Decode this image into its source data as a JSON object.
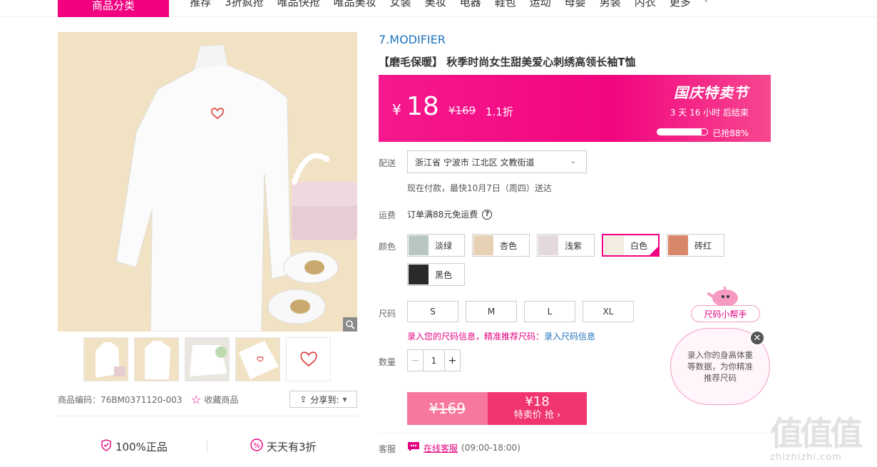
{
  "nav": {
    "category_button": "商品分类",
    "items": [
      "推荐",
      "3折疯抢",
      "唯品快抢",
      "唯品美妆",
      "女装",
      "美妆",
      "电器",
      "鞋包",
      "运动",
      "母婴",
      "男装",
      "内衣",
      "更多"
    ]
  },
  "gallery": {
    "product_code_label": "商品编码：76BM0371120-003",
    "favorite_label": "收藏商品",
    "share_label": "分享到:"
  },
  "guarantees": {
    "authentic": "100%正品",
    "daily_discount": "天天有3折"
  },
  "product": {
    "brand": "7.MODIFIER",
    "title": "【磨毛保暖】 秋季时尚女生甜美爱心刺绣高领长袖T恤"
  },
  "price_banner": {
    "currency": "¥",
    "price": "18",
    "original_price": "¥169",
    "discount": "1.1折",
    "festival": "国庆特卖节",
    "countdown": "3  天  16  小时  后结束",
    "sold_label": "已抢88%",
    "sold_fraction": 0.88
  },
  "delivery": {
    "label": "配送",
    "address": "浙江省 宁波市 江北区 文教街道",
    "note": "现在付款，最快10月7日（周四）送达"
  },
  "shipping": {
    "label": "运费",
    "text": "订单满88元免运费",
    "help": "?"
  },
  "colors": {
    "label": "颜色",
    "options": [
      "淡绿",
      "杏色",
      "浅紫",
      "白色",
      "砖红",
      "黑色"
    ],
    "selected": "白色"
  },
  "sizes": {
    "label": "尺码",
    "options": [
      "S",
      "M",
      "L",
      "XL"
    ],
    "hint_text": "录入您的尺码信息，精准推荐尺码：",
    "hint_link": "录入尺码信息"
  },
  "quantity": {
    "label": "数量",
    "minus": "−",
    "value": "1",
    "plus": "+"
  },
  "buy": {
    "original_price": "¥169",
    "price": "¥18",
    "action": "特卖价 抢 ›"
  },
  "service": {
    "label": "客服",
    "link": "在线客服",
    "hours": "(09:00-18:00)"
  },
  "size_helper": {
    "tag": "尺码小帮手",
    "message": "录入你的身高体重等数据，为你精准推荐尺码",
    "close": "✕"
  },
  "watermark": {
    "glyphs": "值值值",
    "url": "zhizhizhi.com"
  },
  "colors_theme": {
    "accent": "#f10180",
    "link": "#1e73be",
    "buy_now": "#f1356f",
    "buy_orig": "#f7789f"
  }
}
